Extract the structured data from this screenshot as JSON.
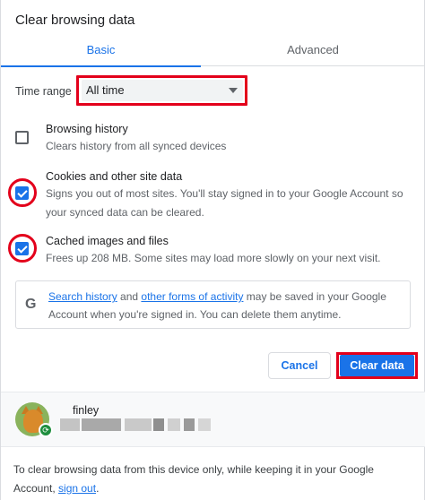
{
  "dialog": {
    "title": "Clear browsing data",
    "tabs": [
      {
        "label": "Basic",
        "active": true
      },
      {
        "label": "Advanced",
        "active": false
      }
    ]
  },
  "time_range": {
    "label": "Time range",
    "selected": "All time"
  },
  "options": [
    {
      "title": "Browsing history",
      "desc": "Clears history from all synced devices",
      "checked": false
    },
    {
      "title": "Cookies and other site data",
      "desc": "Signs you out of most sites. You'll stay signed in to your Google Account so your synced data can be cleared.",
      "checked": true
    },
    {
      "title": "Cached images and files",
      "desc": "Frees up 208 MB. Some sites may load more slowly on your next visit.",
      "checked": true
    }
  ],
  "info": {
    "icon": "google-g-icon",
    "link1": "Search history",
    "text1": " and ",
    "link2": "other forms of activity",
    "text2": " may be saved in your Google Account when you're signed in. You can delete them anytime."
  },
  "buttons": {
    "cancel": "Cancel",
    "clear": "Clear data"
  },
  "account": {
    "name": "finley",
    "sync_icon": "sync-icon"
  },
  "footer": {
    "text": "To clear browsing data from this device only, while keeping it in your Google Account, ",
    "link": "sign out",
    "end": "."
  },
  "colors": {
    "accent": "#1a73e8",
    "highlight": "#e3001b"
  }
}
